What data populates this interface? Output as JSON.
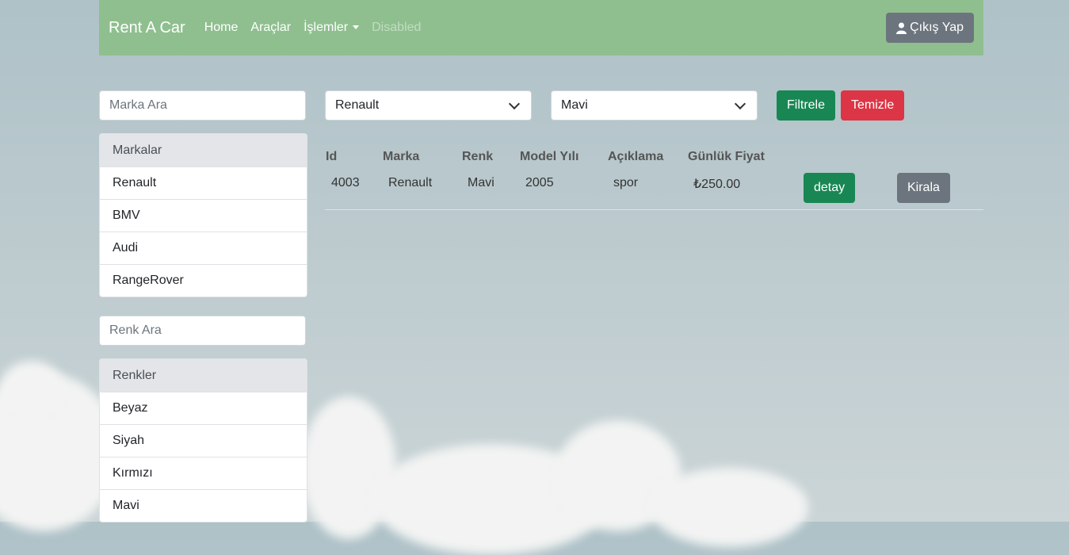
{
  "navbar": {
    "brand": "Rent A Car",
    "links": [
      "Home",
      "Araçlar",
      "İşlemler",
      "Disabled"
    ],
    "logout_label": "Çıkış Yap"
  },
  "filters": {
    "brand_search_placeholder": "Marka Ara",
    "color_search_placeholder": "Renk Ara",
    "brand_select": "Renault",
    "color_select": "Mavi",
    "filter_label": "Filtrele",
    "clear_label": "Temizle"
  },
  "brands": {
    "header": "Markalar",
    "items": [
      "Renault",
      "BMV",
      "Audi",
      "RangeRover"
    ]
  },
  "colors": {
    "header": "Renkler",
    "items": [
      "Beyaz",
      "Siyah",
      "Kırmızı",
      "Mavi"
    ]
  },
  "table": {
    "headers": [
      "Id",
      "Marka",
      "Renk",
      "Model Yılı",
      "Açıklama",
      "Günlük Fiyat"
    ],
    "rows": [
      {
        "id": "4003",
        "brand": "Renault",
        "color": "Mavi",
        "year": "2005",
        "desc": "spor",
        "price": "₺250.00",
        "detail_label": "detay",
        "rent_label": "Kirala"
      }
    ]
  }
}
